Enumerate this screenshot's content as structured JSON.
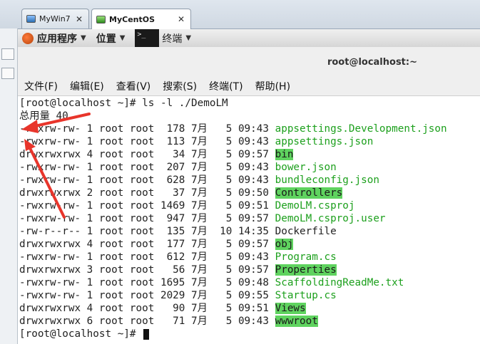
{
  "vm_tabs": [
    {
      "label": "MyWin7",
      "close": "✕"
    },
    {
      "label": "MyCentOS",
      "close": "✕"
    }
  ],
  "panel": {
    "apps": "应用程序",
    "places": "位置",
    "terminal_launcher": "终端",
    "terminal_icon_text": ">_"
  },
  "window_title": "root@localhost:~",
  "menu": [
    "文件(F)",
    "编辑(E)",
    "查看(V)",
    "搜索(S)",
    "终端(T)",
    "帮助(H)"
  ],
  "terminal": {
    "prompt_line": "[root@localhost ~]# ls -l ./DemoLM",
    "total_line": "总用量 40",
    "entries": [
      {
        "meta": "-rwxrw-rw- 1 root root  178 7月   5 09:43 ",
        "name": "appsettings.Development.json",
        "kind": "file"
      },
      {
        "meta": "-rwxrw-rw- 1 root root  113 7月   5 09:43 ",
        "name": "appsettings.json",
        "kind": "file"
      },
      {
        "meta": "drwxrwxrwx 4 root root   34 7月   5 09:57 ",
        "name": "bin",
        "kind": "dir"
      },
      {
        "meta": "-rwxrw-rw- 1 root root  207 7月   5 09:43 ",
        "name": "bower.json",
        "kind": "file"
      },
      {
        "meta": "-rwxrw-rw- 1 root root  628 7月   5 09:43 ",
        "name": "bundleconfig.json",
        "kind": "file"
      },
      {
        "meta": "drwxrwxrwx 2 root root   37 7月   5 09:50 ",
        "name": "Controllers",
        "kind": "dir"
      },
      {
        "meta": "-rwxrw-rw- 1 root root 1469 7月   5 09:51 ",
        "name": "DemoLM.csproj",
        "kind": "file"
      },
      {
        "meta": "-rwxrw-rw- 1 root root  947 7月   5 09:57 ",
        "name": "DemoLM.csproj.user",
        "kind": "file"
      },
      {
        "meta": "-rw-r--r-- 1 root root  135 7月  10 14:35 ",
        "name": "Dockerfile",
        "kind": "plain"
      },
      {
        "meta": "drwxrwxrwx 4 root root  177 7月   5 09:57 ",
        "name": "obj",
        "kind": "dir"
      },
      {
        "meta": "-rwxrw-rw- 1 root root  612 7月   5 09:43 ",
        "name": "Program.cs",
        "kind": "file"
      },
      {
        "meta": "drwxrwxrwx 3 root root   56 7月   5 09:57 ",
        "name": "Properties",
        "kind": "dir"
      },
      {
        "meta": "-rwxrw-rw- 1 root root 1695 7月   5 09:48 ",
        "name": "ScaffoldingReadMe.txt",
        "kind": "file"
      },
      {
        "meta": "-rwxrw-rw- 1 root root 2029 7月   5 09:55 ",
        "name": "Startup.cs",
        "kind": "file"
      },
      {
        "meta": "drwxrwxrwx 4 root root   90 7月   5 09:51 ",
        "name": "Views",
        "kind": "dir"
      },
      {
        "meta": "drwxrwxrwx 6 root root   71 7月   5 09:43 ",
        "name": "wwwroot",
        "kind": "dir"
      }
    ],
    "final_prompt": "[root@localhost ~]# "
  },
  "colors": {
    "file_green": "#1da01d",
    "dir_highlight": "#5fd35f",
    "arrow_red": "#e8352b"
  }
}
